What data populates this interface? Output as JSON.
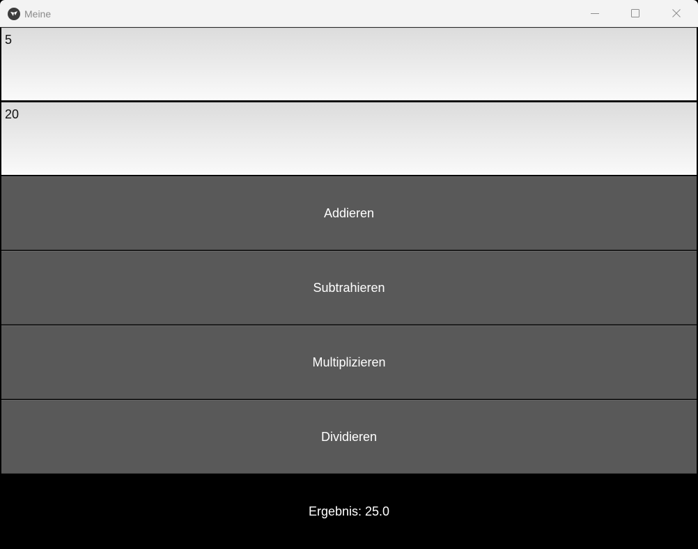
{
  "window": {
    "title": "Meine",
    "icon": "kivy-logo-icon"
  },
  "title_bar_buttons": {
    "minimize_icon": "minimize-icon",
    "maximize_icon": "maximize-icon",
    "close_icon": "close-icon"
  },
  "inputs": {
    "first_value": "5",
    "second_value": "20"
  },
  "buttons": {
    "add_label": "Addieren",
    "subtract_label": "Subtrahieren",
    "multiply_label": "Multiplizieren",
    "divide_label": "Dividieren"
  },
  "result": {
    "text": "Ergebnis: 25.0"
  },
  "colors": {
    "button_bg": "#595959",
    "background": "#000000",
    "titlebar_bg": "#f3f3f3"
  }
}
